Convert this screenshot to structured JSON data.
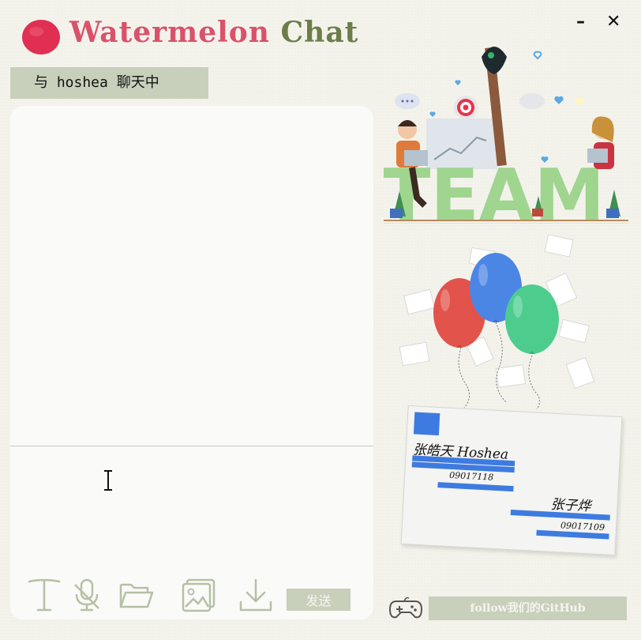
{
  "app": {
    "title_part1": "Watermelon",
    "title_part2": "Chat"
  },
  "window_controls": {
    "minimize": "–",
    "close": "✕"
  },
  "chat_header": {
    "text": "与 hoshea 聊天中"
  },
  "message_input": {
    "value": "",
    "placeholder": ""
  },
  "toolbar": {
    "icons": [
      "text-format-icon",
      "microphone-off-icon",
      "folder-icon",
      "image-icon",
      "download-icon"
    ],
    "send_label": "发送"
  },
  "illustration": {
    "team_word": "TEAM"
  },
  "card": {
    "name1": "张皓天 Hoshea",
    "id1": "09017118",
    "name2": "张子烨",
    "id2": "09017109"
  },
  "footer": {
    "github_label": "follow我们的GitHub",
    "icon": "gamepad-icon"
  },
  "colors": {
    "accent_green": "#c8cfbb",
    "title_pink": "#d9526a",
    "title_green": "#6d7d48",
    "card_blue": "#3e7be0",
    "balloon_red": "#e2534b",
    "balloon_blue": "#4c86e5",
    "balloon_green": "#4ccd8e"
  }
}
